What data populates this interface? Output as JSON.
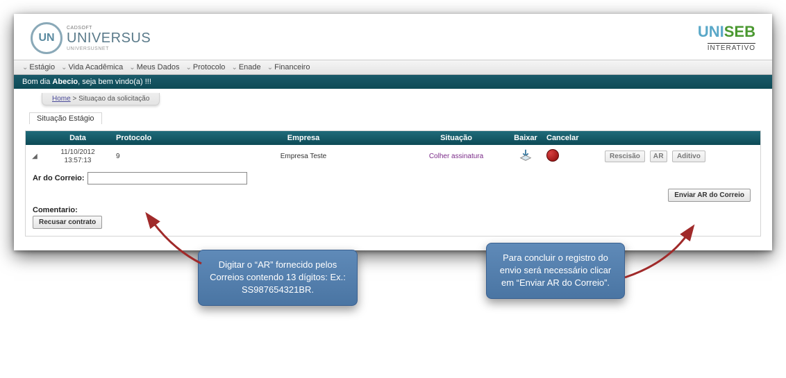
{
  "header": {
    "logo_initials": "UN",
    "logo_small": "CADSOFT",
    "logo_big": "UNIVERSUS",
    "logo_sub": "UNIVERSUSNET",
    "right_brand": "UNISEB",
    "right_sub": "INTERATIVO"
  },
  "menu": {
    "items": [
      "Estágio",
      "Vida Acadêmica",
      "Meus Dados",
      "Protocolo",
      "Enade",
      "Financeiro"
    ]
  },
  "welcome": {
    "prefix": "Bom dia ",
    "user": "Abecio",
    "suffix": ", seja bem vindo(a) !!!"
  },
  "breadcrumb": {
    "home_label": "Home",
    "current": "Situaçao da solicitação"
  },
  "panel": {
    "title": "Situação Estágio",
    "columns": {
      "data": "Data",
      "protocolo": "Protocolo",
      "empresa": "Empresa",
      "situacao": "Situação",
      "baixar": "Baixar",
      "cancelar": "Cancelar"
    },
    "row": {
      "data_line1": "11/10/2012",
      "data_line2": "13:57:13",
      "protocolo": "9",
      "empresa": "Empresa Teste",
      "situacao": "Colher assinatura",
      "btn_rescisao": "Rescisão",
      "btn_ar": "AR",
      "btn_aditivo": "Aditivo"
    },
    "ar_label": "Ar do Correio:",
    "ar_value": "",
    "btn_enviar": "Enviar AR do Correio",
    "comentario_label": "Comentario:",
    "btn_recusar": "Recusar contrato"
  },
  "callouts": {
    "c1": "Digitar o “AR” fornecido pelos Correios  contendo 13 dígitos: Ex.: SS987654321BR.",
    "c2": "Para concluir o registro do envio será necessário clicar em “Enviar AR do Correio”."
  },
  "colors": {
    "brand_teal": "#155a68",
    "callout_blue": "#5b86b4",
    "situacao_purple": "#7a2a88"
  }
}
